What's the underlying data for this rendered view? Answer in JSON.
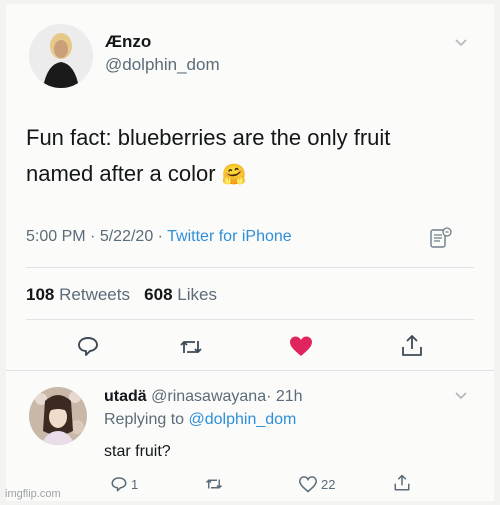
{
  "tweet": {
    "author_name": "Ænzo",
    "author_handle": "@dolphin_dom",
    "text_line1": "Fun fact: blueberries are the only fruit",
    "text_line2": "named after a color",
    "emoji": "🤗",
    "time": "5:00 PM",
    "dot1": "·",
    "date": "5/22/20",
    "dot2": "·",
    "source": "Twitter for iPhone",
    "retweet_count": "108",
    "retweet_label": "Retweets",
    "like_count": "608",
    "like_label": "Likes",
    "liked_color": "#e0245e",
    "actions": [
      "reply-icon",
      "retweet-icon",
      "like-icon-filled",
      "share-icon"
    ]
  },
  "reply": {
    "author_name": "utadä",
    "author_handle": "@rinasawayana",
    "dot": "·",
    "age": "21h",
    "replying_prefix": "Replying to",
    "replying_to": "@dolphin_dom",
    "text": "star fruit?",
    "reply_count": "1",
    "like_count": "22",
    "actions": [
      "reply-icon",
      "retweet-icon",
      "like-icon",
      "share-icon"
    ]
  },
  "watermark": "imgflip.com",
  "colors": {
    "link": "#2f8fd8",
    "muted": "#5b6b78",
    "background": "#fbfbfa"
  }
}
